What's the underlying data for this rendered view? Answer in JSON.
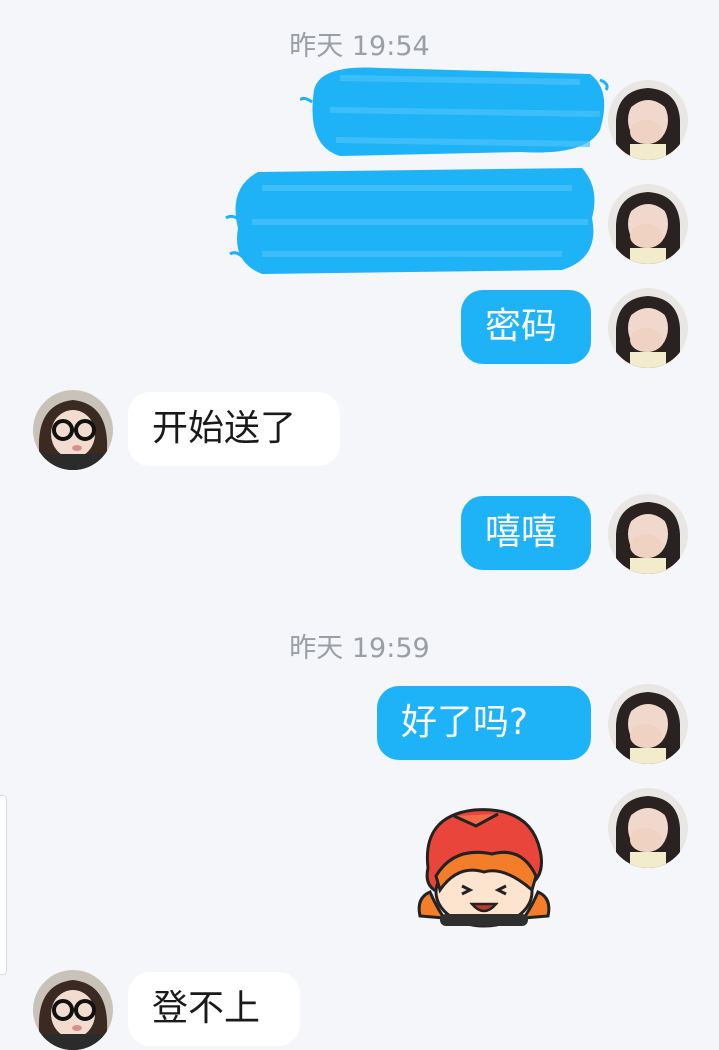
{
  "chat": {
    "timestamps": [
      "昨天 19:54",
      "昨天 19:59"
    ],
    "messages": [
      {
        "side": "out",
        "kind": "redacted"
      },
      {
        "side": "out",
        "kind": "redacted"
      },
      {
        "side": "out",
        "kind": "text",
        "text": "密码"
      },
      {
        "side": "in",
        "kind": "text",
        "text": "开始送了"
      },
      {
        "side": "out",
        "kind": "text",
        "text": "嘻嘻"
      },
      {
        "side": "out",
        "kind": "text",
        "text": "好了吗?"
      },
      {
        "side": "out",
        "kind": "sticker",
        "sticker": "cartoon-girl-sticker"
      },
      {
        "side": "in",
        "kind": "text",
        "text": "登不上"
      }
    ]
  },
  "colors": {
    "background": "#f4f6f9",
    "outgoing_bubble": "#1eb2f7",
    "incoming_bubble": "#ffffff",
    "timestamp_text": "#9a9ea5"
  }
}
